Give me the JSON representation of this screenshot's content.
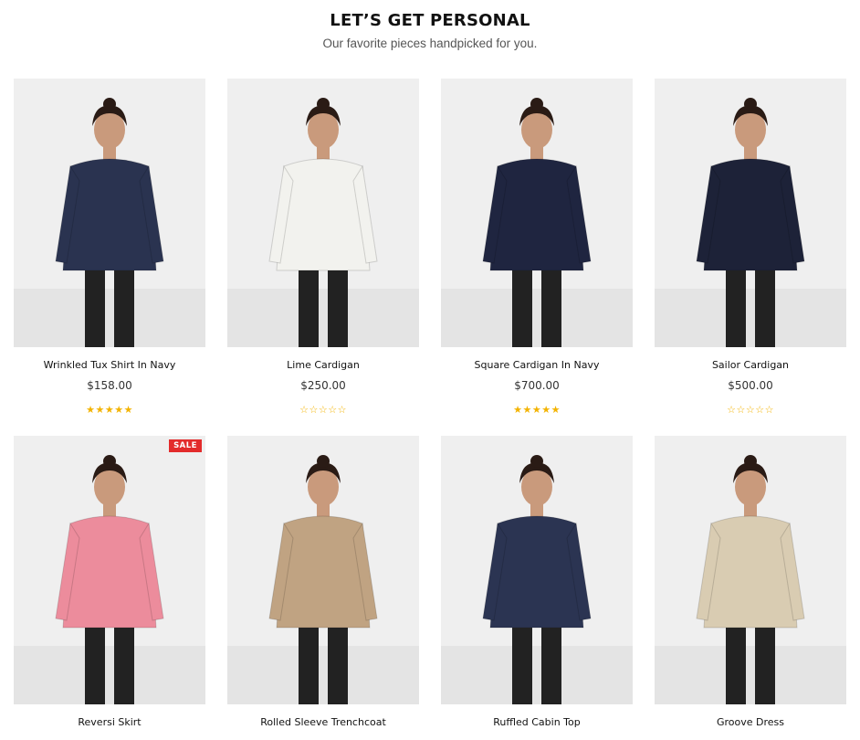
{
  "section": {
    "title": "LET’S GET PERSONAL",
    "subtitle": "Our favorite pieces handpicked for you."
  },
  "colors": {
    "star": "#f3b300",
    "sale_badge": "#e32b2b"
  },
  "products": [
    {
      "name": "Wrinkled Tux Shirt In Navy",
      "price": "$158.00",
      "rating": 5,
      "max_rating": 5,
      "sale": false,
      "garment_color": "#2a3350",
      "image_icon": "model-photo-icon"
    },
    {
      "name": "Lime Cardigan",
      "price": "$250.00",
      "rating": 0,
      "max_rating": 5,
      "sale": false,
      "garment_color": "#f2f2ee",
      "image_icon": "model-photo-icon"
    },
    {
      "name": "Square Cardigan In Navy",
      "price": "$700.00",
      "rating": 5,
      "max_rating": 5,
      "sale": false,
      "garment_color": "#1f2540",
      "image_icon": "model-photo-icon"
    },
    {
      "name": "Sailor Cardigan",
      "price": "$500.00",
      "rating": 0,
      "max_rating": 5,
      "sale": false,
      "garment_color": "#1d2238",
      "image_icon": "model-photo-icon"
    },
    {
      "name": "Reversi Skirt",
      "price": "",
      "rating": null,
      "max_rating": 5,
      "sale": true,
      "sale_label": "SALE",
      "garment_color": "#ec8c9c",
      "image_icon": "model-photo-icon"
    },
    {
      "name": "Rolled Sleeve Trenchcoat",
      "price": "",
      "rating": null,
      "max_rating": 5,
      "sale": false,
      "garment_color": "#c0a382",
      "image_icon": "model-photo-icon"
    },
    {
      "name": "Ruffled Cabin Top",
      "price": "",
      "rating": null,
      "max_rating": 5,
      "sale": false,
      "garment_color": "#2b3452",
      "image_icon": "model-photo-icon"
    },
    {
      "name": "Groove Dress",
      "price": "",
      "rating": null,
      "max_rating": 5,
      "sale": false,
      "garment_color": "#d9ccb2",
      "image_icon": "model-photo-icon"
    }
  ]
}
